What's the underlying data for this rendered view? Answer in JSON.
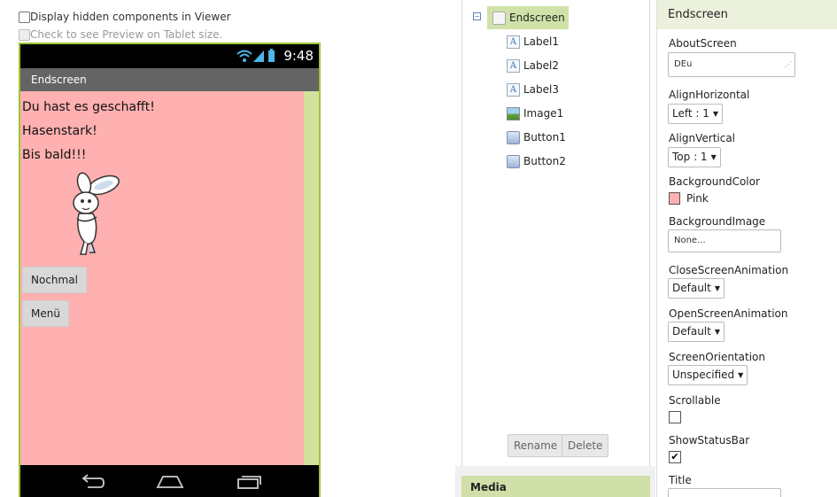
{
  "viewer": {
    "hidden_components_label": "Display hidden components in Viewer",
    "tablet_preview_label": "Check to see Preview on Tablet size.",
    "status_time": "9:48",
    "screen_title": "Endscreen",
    "labels": [
      "Du hast es geschafft!",
      "Hasenstark!",
      "Bis bald!!!"
    ],
    "buttons": [
      "Nochmal",
      "Menü"
    ],
    "background_color": "#ffb0b0"
  },
  "components": {
    "root": "Endscreen",
    "items": [
      {
        "name": "Label1",
        "icon": "label-icon"
      },
      {
        "name": "Label2",
        "icon": "label-icon"
      },
      {
        "name": "Label3",
        "icon": "label-icon"
      },
      {
        "name": "Image1",
        "icon": "image-icon"
      },
      {
        "name": "Button1",
        "icon": "button-icon"
      },
      {
        "name": "Button2",
        "icon": "button-icon"
      }
    ],
    "rename_label": "Rename",
    "delete_label": "Delete",
    "media_label": "Media"
  },
  "properties": {
    "header": "Endscreen",
    "about_screen": {
      "label": "AboutScreen",
      "value": "DEu"
    },
    "align_horizontal": {
      "label": "AlignHorizontal",
      "value": "Left : 1"
    },
    "align_vertical": {
      "label": "AlignVertical",
      "value": "Top : 1"
    },
    "background_color": {
      "label": "BackgroundColor",
      "value": "Pink",
      "swatch": "#ffb0b0"
    },
    "background_image": {
      "label": "BackgroundImage",
      "value": "None..."
    },
    "close_screen_animation": {
      "label": "CloseScreenAnimation",
      "value": "Default"
    },
    "open_screen_animation": {
      "label": "OpenScreenAnimation",
      "value": "Default"
    },
    "screen_orientation": {
      "label": "ScreenOrientation",
      "value": "Unspecified"
    },
    "scrollable": {
      "label": "Scrollable",
      "checked": false
    },
    "show_status_bar": {
      "label": "ShowStatusBar",
      "checked": true
    },
    "title": {
      "label": "Title"
    }
  },
  "colors": {
    "accent_green": "#9fc33b",
    "tree_selected": "#d0e2a8",
    "app_pink": "#ffb0b0"
  }
}
